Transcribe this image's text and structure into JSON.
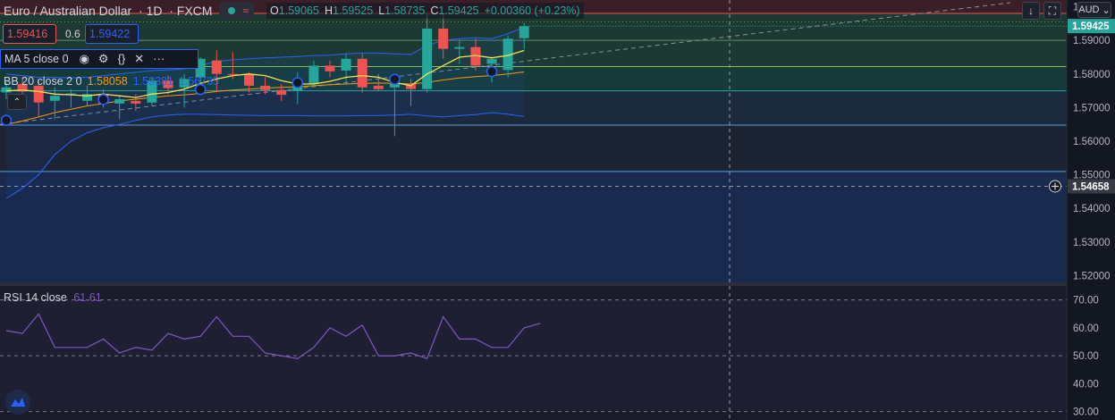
{
  "header": {
    "symbol": "Euro / Australian Dollar",
    "interval": "1D",
    "exchange": "FXCM",
    "ohlc": {
      "o_label": "O",
      "o": "1.59065",
      "h_label": "H",
      "h": "1.59525",
      "l_label": "L",
      "l": "1.58735",
      "c_label": "C",
      "c": "1.59425",
      "change": "+0.00360 (+0.23%)"
    }
  },
  "trade": {
    "sell": "1.59416",
    "spread": "0.6",
    "buy": "1.59422"
  },
  "indicators": {
    "ma": {
      "label": "MA 5 close 0"
    },
    "bb": {
      "label": "BB 20 close 2 0",
      "basis": "1.58058",
      "upper": "1.59381",
      "lower": "1.56735"
    },
    "rsi": {
      "label": "RSI 14 close",
      "value": "61.61"
    }
  },
  "toolbar": {
    "currency": "AUD"
  },
  "price_axis": {
    "ticks": [
      "1.60000",
      "1.59000",
      "1.58000",
      "1.57000",
      "1.56000",
      "1.55000",
      "1.54000",
      "1.53000",
      "1.52000"
    ],
    "current_price": "1.59425",
    "crosshair_price": "1.54658"
  },
  "rsi_axis": {
    "ticks": [
      "70.00",
      "60.00",
      "50.00",
      "40.00",
      "30.00"
    ]
  },
  "colors": {
    "bull": "#26a69a",
    "bear": "#ef5350",
    "ma": "#f7e34a",
    "bb_basis": "#ff9800",
    "bb_band": "#2962ff",
    "rsi": "#7e57c2",
    "bg": "#131722"
  },
  "chart_data": {
    "type": "candlestick",
    "ylim": [
      1.518,
      1.602
    ],
    "candles": [
      {
        "o": 1.5745,
        "h": 1.5775,
        "l": 1.5725,
        "c": 1.576
      },
      {
        "o": 1.577,
        "h": 1.579,
        "l": 1.574,
        "c": 1.5748
      },
      {
        "o": 1.5765,
        "h": 1.5785,
        "l": 1.5672,
        "c": 1.5715
      },
      {
        "o": 1.572,
        "h": 1.576,
        "l": 1.5665,
        "c": 1.5735
      },
      {
        "o": 1.574,
        "h": 1.5755,
        "l": 1.57,
        "c": 1.5742
      },
      {
        "o": 1.572,
        "h": 1.5765,
        "l": 1.5705,
        "c": 1.574
      },
      {
        "o": 1.574,
        "h": 1.5755,
        "l": 1.57,
        "c": 1.5712
      },
      {
        "o": 1.5712,
        "h": 1.5735,
        "l": 1.5665,
        "c": 1.5725
      },
      {
        "o": 1.572,
        "h": 1.574,
        "l": 1.569,
        "c": 1.5712
      },
      {
        "o": 1.5715,
        "h": 1.579,
        "l": 1.5705,
        "c": 1.578
      },
      {
        "o": 1.578,
        "h": 1.5795,
        "l": 1.574,
        "c": 1.5758
      },
      {
        "o": 1.576,
        "h": 1.58,
        "l": 1.57,
        "c": 1.5785
      },
      {
        "o": 1.579,
        "h": 1.585,
        "l": 1.5775,
        "c": 1.5845
      },
      {
        "o": 1.584,
        "h": 1.587,
        "l": 1.575,
        "c": 1.58
      },
      {
        "o": 1.58,
        "h": 1.5865,
        "l": 1.5785,
        "c": 1.5798
      },
      {
        "o": 1.5798,
        "h": 1.5805,
        "l": 1.5745,
        "c": 1.5765
      },
      {
        "o": 1.5765,
        "h": 1.579,
        "l": 1.574,
        "c": 1.5752
      },
      {
        "o": 1.5752,
        "h": 1.577,
        "l": 1.572,
        "c": 1.5738
      },
      {
        "o": 1.575,
        "h": 1.5805,
        "l": 1.571,
        "c": 1.5765
      },
      {
        "o": 1.577,
        "h": 1.584,
        "l": 1.5765,
        "c": 1.5825
      },
      {
        "o": 1.5825,
        "h": 1.584,
        "l": 1.579,
        "c": 1.5808
      },
      {
        "o": 1.581,
        "h": 1.586,
        "l": 1.577,
        "c": 1.5845
      },
      {
        "o": 1.5845,
        "h": 1.586,
        "l": 1.5745,
        "c": 1.576
      },
      {
        "o": 1.5765,
        "h": 1.58,
        "l": 1.575,
        "c": 1.5755
      },
      {
        "o": 1.576,
        "h": 1.579,
        "l": 1.5615,
        "c": 1.577
      },
      {
        "o": 1.577,
        "h": 1.5785,
        "l": 1.5705,
        "c": 1.5755
      },
      {
        "o": 1.5755,
        "h": 1.598,
        "l": 1.5745,
        "c": 1.5935
      },
      {
        "o": 1.5935,
        "h": 1.598,
        "l": 1.5845,
        "c": 1.5875
      },
      {
        "o": 1.5875,
        "h": 1.59,
        "l": 1.583,
        "c": 1.588
      },
      {
        "o": 1.588,
        "h": 1.5905,
        "l": 1.581,
        "c": 1.5825
      },
      {
        "o": 1.583,
        "h": 1.585,
        "l": 1.5775,
        "c": 1.5845
      },
      {
        "o": 1.5812,
        "h": 1.5915,
        "l": 1.579,
        "c": 1.5905
      },
      {
        "o": 1.59065,
        "h": 1.59525,
        "l": 1.58735,
        "c": 1.59425
      }
    ],
    "ma5": [
      1.575,
      1.5752,
      1.5748,
      1.574,
      1.5738,
      1.5735,
      1.574,
      1.5735,
      1.573,
      1.574,
      1.5745,
      1.5755,
      1.5772,
      1.5785,
      1.5795,
      1.58,
      1.5795,
      1.578,
      1.577,
      1.577,
      1.5778,
      1.579,
      1.5795,
      1.579,
      1.5775,
      1.5765,
      1.58,
      1.5825,
      1.585,
      1.5855,
      1.5848,
      1.5855,
      1.587
    ],
    "bb_basis": [
      1.565,
      1.566,
      1.5672,
      1.5685,
      1.5695,
      1.5705,
      1.5712,
      1.572,
      1.5725,
      1.573,
      1.5735,
      1.5738,
      1.5742,
      1.5748,
      1.5752,
      1.5755,
      1.5758,
      1.576,
      1.5762,
      1.5765,
      1.5768,
      1.577,
      1.5772,
      1.5773,
      1.5772,
      1.577,
      1.5775,
      1.5782,
      1.5788,
      1.5792,
      1.5795,
      1.58,
      1.5806
    ],
    "bb_upper": [
      1.58,
      1.5795,
      1.579,
      1.579,
      1.5788,
      1.579,
      1.5795,
      1.58,
      1.5805,
      1.581,
      1.5812,
      1.5815,
      1.5825,
      1.5838,
      1.5842,
      1.5845,
      1.5848,
      1.585,
      1.5852,
      1.5855,
      1.5856,
      1.586,
      1.5862,
      1.5862,
      1.586,
      1.5858,
      1.5885,
      1.59,
      1.5905,
      1.5908,
      1.5905,
      1.592,
      1.5938
    ],
    "bb_lower": [
      1.543,
      1.546,
      1.55,
      1.556,
      1.56,
      1.5625,
      1.564,
      1.565,
      1.5662,
      1.5672,
      1.5678,
      1.568,
      1.568,
      1.5679,
      1.5678,
      1.5677,
      1.5676,
      1.5676,
      1.5676,
      1.5675,
      1.5675,
      1.5675,
      1.5676,
      1.5676,
      1.5678,
      1.568,
      1.5675,
      1.5672,
      1.5676,
      1.5679,
      1.5685,
      1.568,
      1.5673
    ],
    "rsi": [
      59,
      58,
      65,
      53,
      53,
      53,
      56,
      51,
      53,
      52,
      58,
      56,
      57,
      64,
      57,
      57,
      51,
      50,
      49,
      53,
      60,
      57,
      61,
      50,
      50,
      51,
      49,
      64,
      56,
      56,
      53,
      53,
      60,
      61.61
    ],
    "rsi_ylim": [
      27,
      75
    ],
    "h_levels": [
      1.598,
      1.59,
      1.5822,
      1.575,
      1.5648,
      1.551
    ],
    "crosshair": {
      "price": 1.54658
    }
  }
}
